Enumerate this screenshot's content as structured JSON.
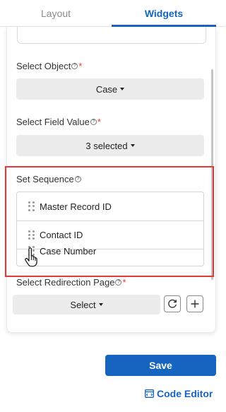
{
  "tabs": [
    {
      "label": "Layout",
      "active": false
    },
    {
      "label": "Widgets",
      "active": true
    }
  ],
  "fields": {
    "select_object": {
      "label": "Select Object",
      "required": "*",
      "value": "Case"
    },
    "select_field_value": {
      "label": "Select Field Value",
      "required": "*",
      "value": "3 selected"
    },
    "set_sequence": {
      "label": "Set Sequence",
      "items": [
        "Master Record ID",
        "Contact ID",
        "Case Number"
      ]
    },
    "select_redirection_page": {
      "label": "Select Redirection Page",
      "required": "*",
      "value": "Select"
    }
  },
  "help_glyph": "?",
  "actions": {
    "save_label": "Save",
    "code_editor_label": "Code Editor"
  },
  "colors": {
    "accent": "#1565c0",
    "required": "#e53935",
    "highlight_border": "#e53935",
    "dropdown_bg": "#ececec"
  },
  "icons": {
    "help": "question-circle-icon",
    "drag": "drag-handle-icon",
    "refresh": "refresh-icon",
    "add": "plus-icon",
    "code": "code-editor-icon",
    "cursor": "hand-pointer-icon"
  }
}
